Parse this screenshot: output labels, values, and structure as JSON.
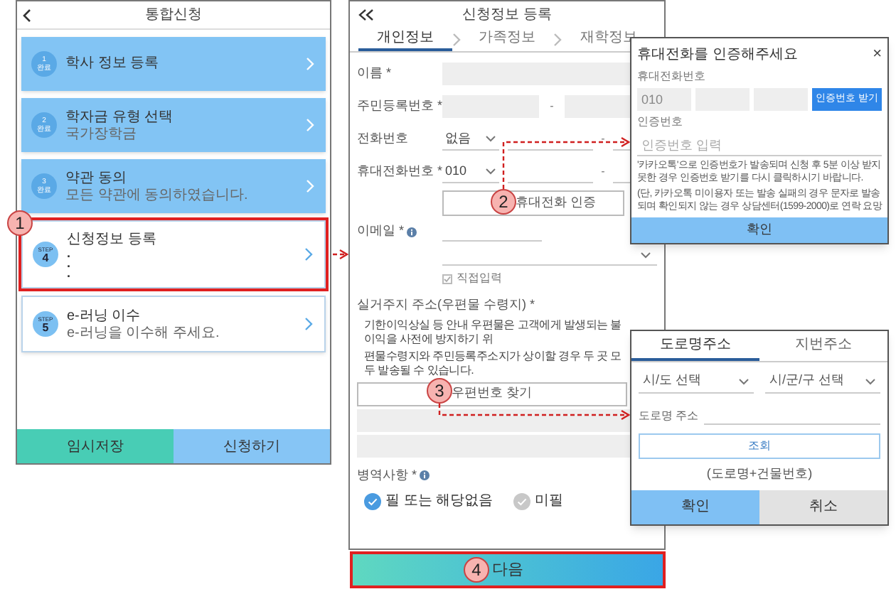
{
  "callouts": [
    "1",
    "2",
    "3",
    "4"
  ],
  "step_screen": {
    "title": "통합신청",
    "steps": [
      {
        "kind": "done",
        "number": "1",
        "status": "완료",
        "title": "학사 정보 등록",
        "highlighted": false
      },
      {
        "kind": "done",
        "number": "2",
        "status": "완료",
        "title": "학자금 유형 선택",
        "subtitle": "국가장학금",
        "highlighted": false
      },
      {
        "kind": "done",
        "number": "3",
        "status": "완료",
        "title": "약관 동의",
        "subtitle": "모든 약관에 동의하였습니다.",
        "highlighted": false
      },
      {
        "kind": "step",
        "step_label": "STEP",
        "number": "4",
        "title": "신청정보 등록",
        "bullets": [
          ".",
          ".",
          "."
        ],
        "highlighted": true
      },
      {
        "kind": "step",
        "step_label": "STEP",
        "number": "5",
        "title": "e-러닝 이수",
        "subtitle": "e-러닝을 이수해 주세요.",
        "highlighted": false
      }
    ],
    "buttons": [
      {
        "label": "임시저장",
        "kind": "secondary"
      },
      {
        "label": "신청하기",
        "kind": "primary"
      }
    ]
  },
  "form_screen": {
    "title": "신청정보 등록",
    "tabs": [
      {
        "label": "개인정보",
        "selected": true
      },
      {
        "label": "가족정보",
        "selected": false
      },
      {
        "label": "재학정보",
        "selected": false
      }
    ],
    "fields": [
      {
        "kind": "text",
        "label": "이름 *"
      },
      {
        "kind": "split",
        "label": "주민등록번호 *",
        "separator": "-"
      },
      {
        "kind": "phone",
        "label": "전화번호",
        "value": "없음",
        "separator": "-"
      },
      {
        "kind": "phone",
        "label": "휴대전화번호 *",
        "value": "010",
        "separator": "-"
      },
      {
        "kind": "button",
        "label": "휴대전화 인증"
      },
      {
        "kind": "email",
        "label": "이메일 *",
        "info": true
      },
      {
        "kind": "checkbox",
        "label": "직접입력",
        "checked": true
      },
      {
        "kind": "address",
        "label": "실거주지 주소(우편물 수령지) *",
        "notes": [
          "기한이익상실 등 안내 우편물은 고객에게 발생되는 불이익을 사전에 방지하기 위",
          "편물수령지와 주민등록주소지가 상이할 경우 두 곳 모두 발송될 수 있습니다."
        ],
        "button": "우편번호 찾기"
      },
      {
        "kind": "radio",
        "label": "병역사항 *",
        "info": true,
        "options": [
          {
            "label": "필 또는 해당없음",
            "selected": true
          },
          {
            "label": "미필",
            "selected": false
          }
        ]
      }
    ],
    "next_button": "다음"
  },
  "phone_dialog": {
    "title": "휴대전화를 인증해주세요",
    "close": "×",
    "phone_label": "휴대전화번호",
    "phone_prefix": "010",
    "request_button": "인증번호 받기",
    "code_label": "인증번호",
    "code_placeholder": "인증번호 입력",
    "notes": [
      "'카카오톡'으로 인증번호가 발송되며 신청 후 5분 이상 받지 못한 경우 인증번호 받기를 다시 클릭하시기 바랍니다.",
      "(단, 카카오톡 미이용자 또는 발송 실패의 경우 문자로 발송되며 확인되지 않는 경우 상담센터(1599-2000)로 연락 요망"
    ],
    "confirm_button": "확인"
  },
  "address_dialog": {
    "tabs": [
      {
        "label": "도로명주소",
        "selected": true
      },
      {
        "label": "지번주소",
        "selected": false
      }
    ],
    "selects": [
      "시/도 선택",
      "시/군/구 선택"
    ],
    "road_label": "도로명 주소",
    "search_button": "조회",
    "hint": "(도로명+건물번호)",
    "buttons": [
      {
        "label": "확인",
        "kind": "primary"
      },
      {
        "label": "취소",
        "kind": "secondary"
      }
    ]
  }
}
